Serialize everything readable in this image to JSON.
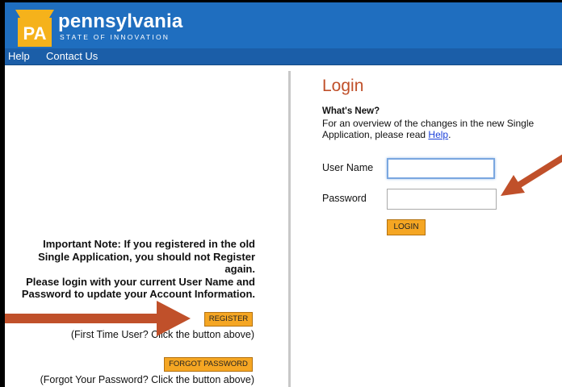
{
  "header": {
    "badge": "PA",
    "brand_name": "pennsylvania",
    "tagline": "STATE OF INNOVATION",
    "accent_color": "#1f6ebf"
  },
  "nav": {
    "items": [
      {
        "label": "Help"
      },
      {
        "label": "Contact Us"
      }
    ]
  },
  "left": {
    "note": [
      "Important Note: If you registered in the old",
      "Single Application, you should not Register",
      "again.",
      "Please login with your current User Name and",
      "Password to update your Account Information."
    ],
    "register_label": "REGISTER",
    "register_hint": "(First Time User? Click the button above)",
    "forgot_label": "FORGOT PASSWORD",
    "forgot_hint": "(Forgot Your Password? Click the button above)"
  },
  "login": {
    "title": "Login",
    "whats_new": "What's New?",
    "overview_text": "For an overview of the changes in the new Single Application, please read ",
    "help_link": "Help",
    "overview_end": ".",
    "username_label": "User Name",
    "username_value": "",
    "password_label": "Password",
    "password_value": "",
    "login_label": "LOGIN"
  },
  "annotation_color": "#c0502a"
}
